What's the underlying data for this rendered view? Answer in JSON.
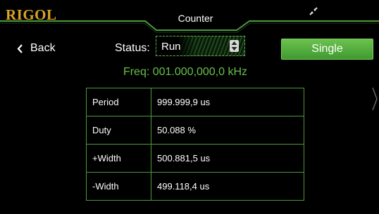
{
  "header": {
    "logo": "RIGOL",
    "title": "Counter",
    "connection_icon": "usb-link-icon",
    "accent_color": "#5fb54a",
    "logo_color": "#d9a424"
  },
  "nav": {
    "back_label": "Back"
  },
  "status": {
    "label": "Status:",
    "value": "Run"
  },
  "actions": {
    "single_label": "Single"
  },
  "frequency": {
    "text": "Freq: 001.000,000,0 kHz"
  },
  "measurements": [
    {
      "name": "Period",
      "value": "999.999,9 us"
    },
    {
      "name": "Duty",
      "value": "50.088 %"
    },
    {
      "name": "+Width",
      "value": "500.881,5 us"
    },
    {
      "name": "-Width",
      "value": "499.118,4 us"
    }
  ]
}
